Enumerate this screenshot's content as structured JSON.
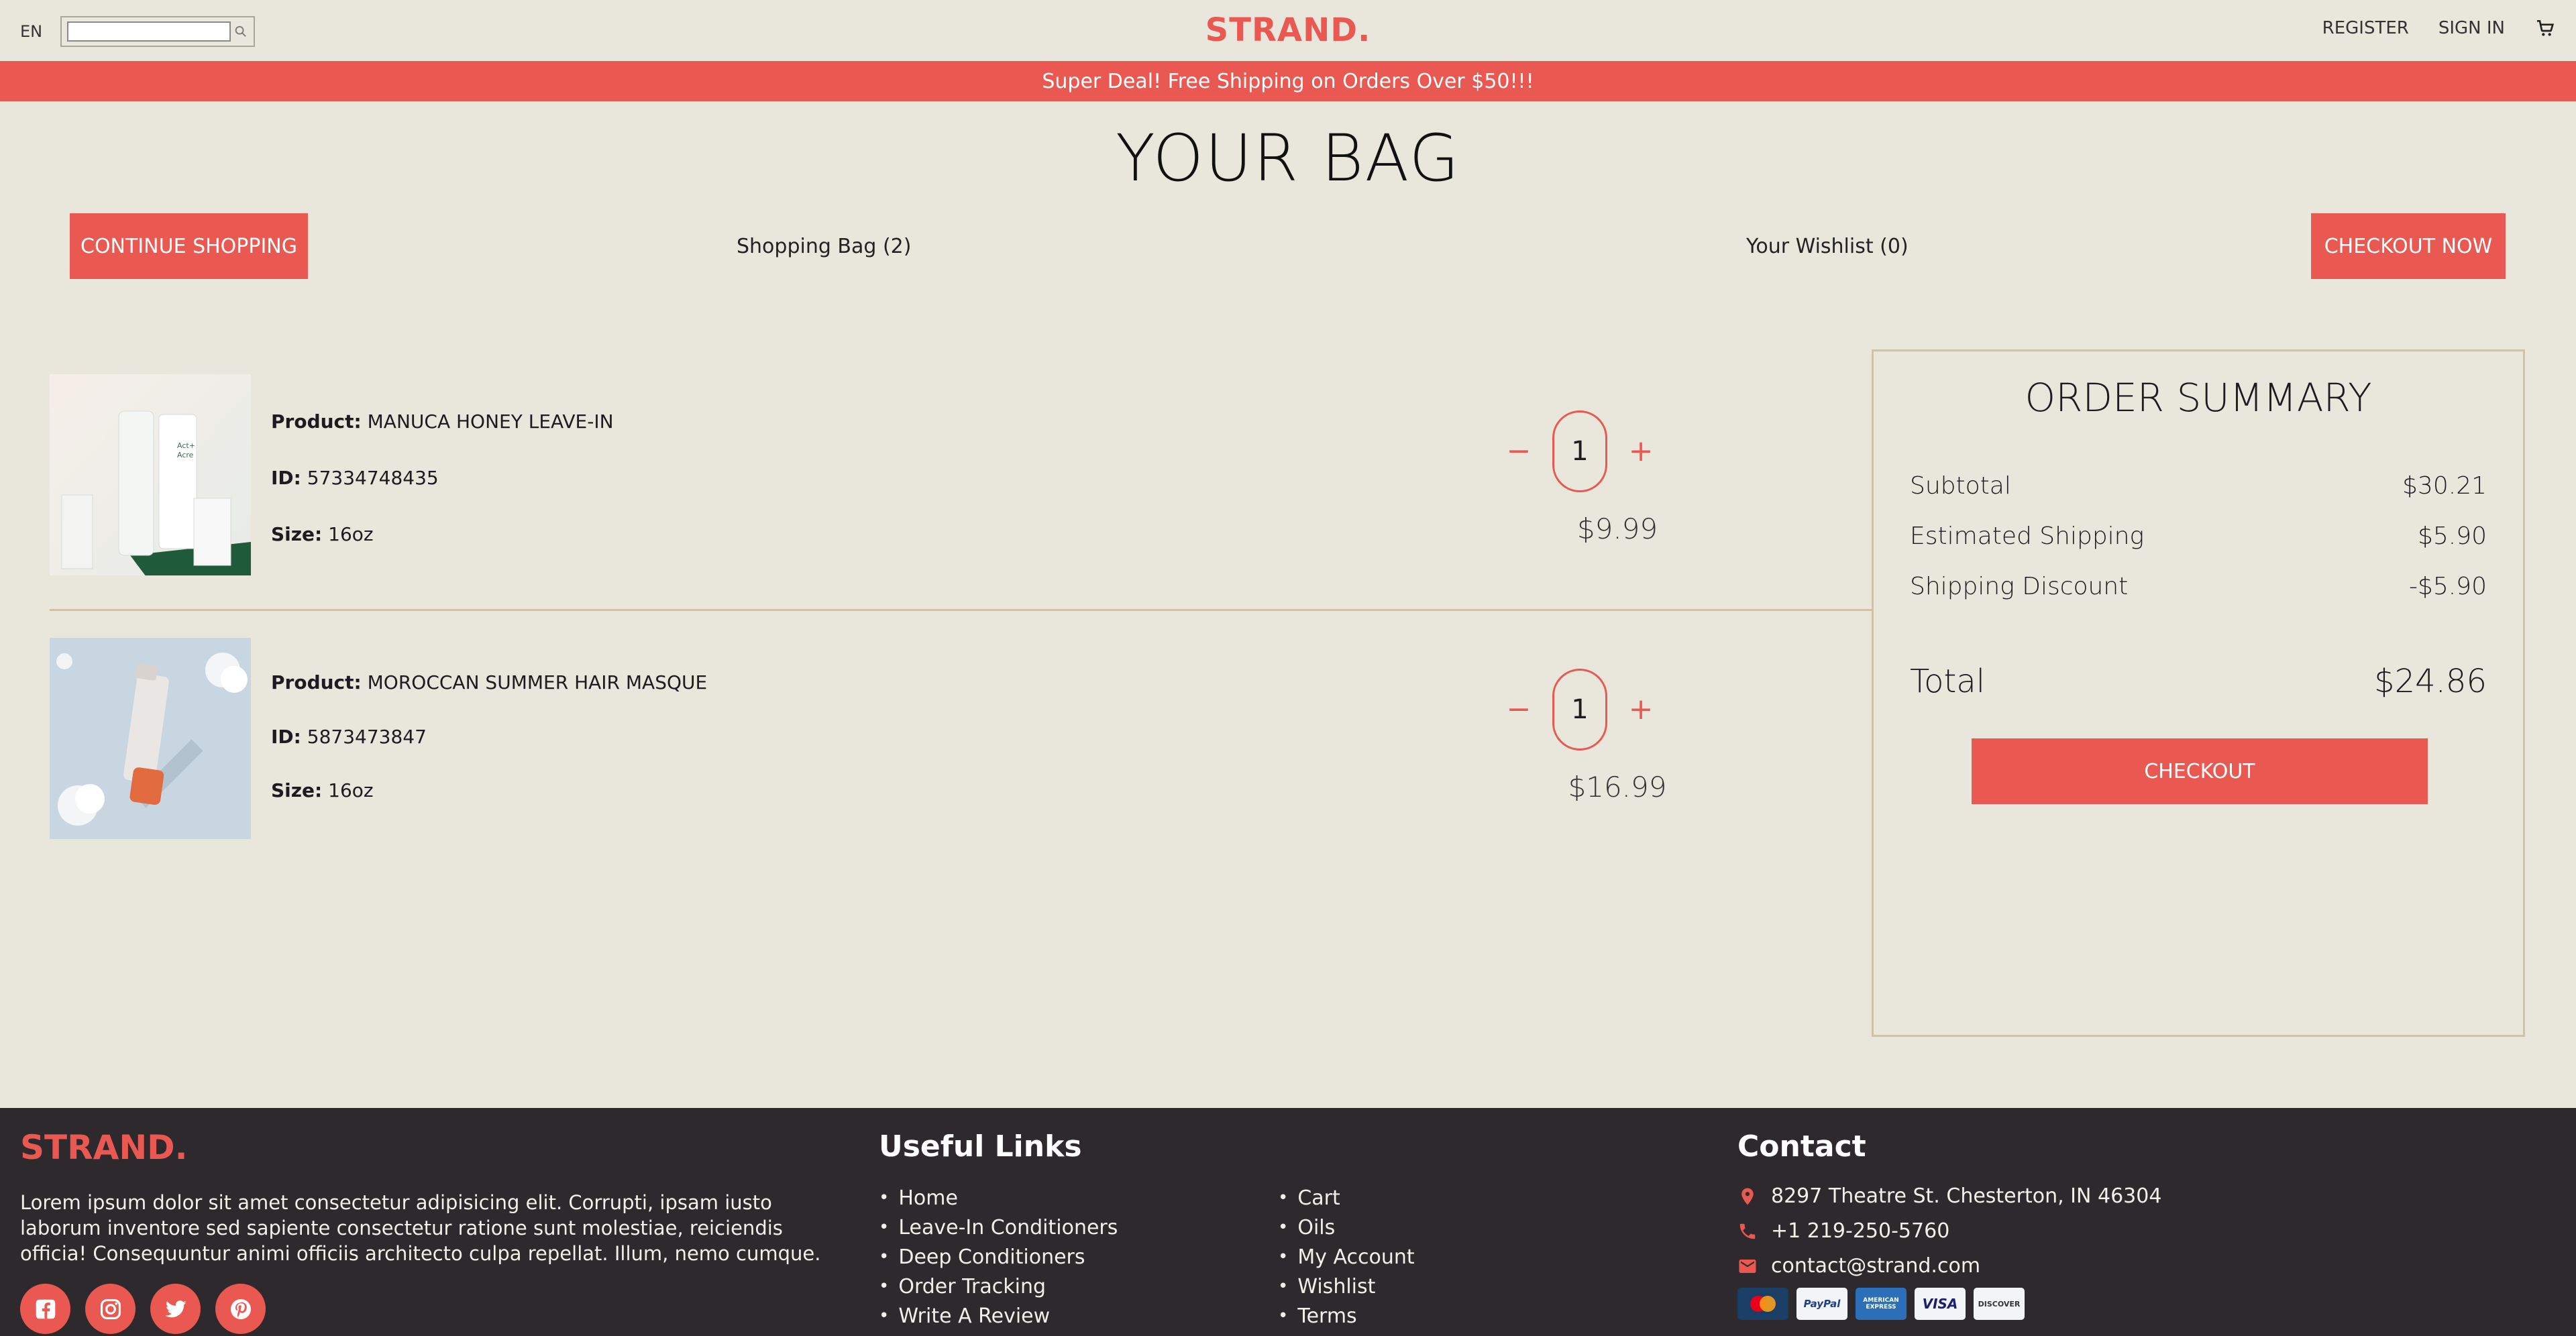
{
  "header": {
    "language": "EN",
    "search_placeholder": "",
    "logo": "STRAND.",
    "register": "REGISTER",
    "sign_in": "SIGN IN"
  },
  "announcement": "Super Deal! Free Shipping on Orders Over $50!!!",
  "page": {
    "title": "YOUR BAG",
    "continue_shopping": "CONTINUE SHOPPING",
    "shopping_bag": "Shopping Bag (2)",
    "wishlist": "Your Wishlist (0)",
    "checkout_now": "CHECKOUT NOW"
  },
  "labels": {
    "product": "Product:",
    "id": "ID:",
    "size": "Size:"
  },
  "products": [
    {
      "name": "MANUCA HONEY LEAVE-IN",
      "id": "57334748435",
      "size": "16oz",
      "quantity": "1",
      "price": "$9.99"
    },
    {
      "name": "MOROCCAN SUMMER HAIR MASQUE",
      "id": "5873473847",
      "size": "16oz",
      "quantity": "1",
      "price": "$16.99"
    }
  ],
  "summary": {
    "title": "ORDER SUMMARY",
    "subtotal_label": "Subtotal",
    "subtotal": "$30.21",
    "shipping_label": "Estimated Shipping",
    "shipping": "$5.90",
    "discount_label": "Shipping Discount",
    "discount": "-$5.90",
    "total_label": "Total",
    "total": "$24.86",
    "checkout": "CHECKOUT"
  },
  "footer": {
    "logo": "STRAND.",
    "description": "Lorem ipsum dolor sit amet consectetur adipisicing elit. Corrupti, ipsam iusto laborum inventore sed sapiente consectetur ratione sunt molestiae, reiciendis officia! Consequuntur animi officiis architecto culpa repellat. Illum, nemo cumque.",
    "links_heading": "Useful Links",
    "links_col1": [
      "Home",
      "Leave-In Conditioners",
      "Deep Conditioners",
      "Order Tracking",
      "Write A Review"
    ],
    "links_col2": [
      "Cart",
      "Oils",
      "My Account",
      "Wishlist",
      "Terms"
    ],
    "contact_heading": "Contact",
    "address": "8297 Theatre St. Chesterton, IN 46304",
    "phone": "+1 219-250-5760",
    "email": "contact@strand.com",
    "payment_cards": [
      "MasterCard",
      "PayPal",
      "AMERICAN EXPRESS",
      "VISA",
      "DISCOVER"
    ]
  },
  "colors": {
    "accent": "#e95951",
    "background": "#e9e6dc",
    "footer": "#2d292c",
    "border": "#cfc2a6"
  }
}
